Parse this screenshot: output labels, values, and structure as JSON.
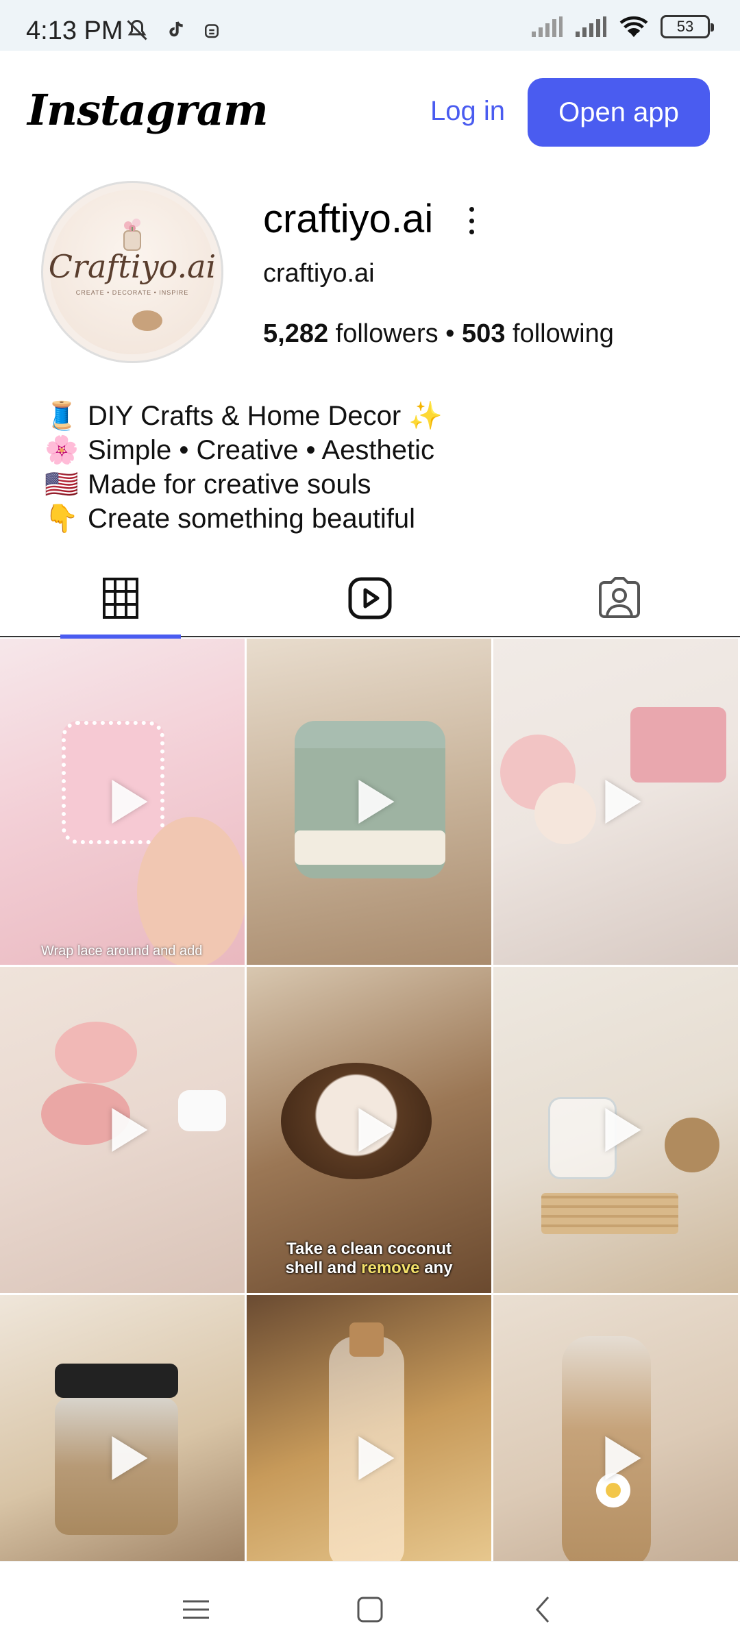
{
  "status_bar": {
    "time": "4:13 PM",
    "battery": "53",
    "icons_left": [
      "mute-icon",
      "tiktok-icon",
      "robot-icon"
    ],
    "icons_right": [
      "signal-icon",
      "signal-icon",
      "wifi-icon",
      "battery-icon"
    ]
  },
  "header": {
    "logo": "Instagram",
    "login_label": "Log in",
    "open_app_label": "Open app",
    "accent_color": "#4a5cf0"
  },
  "profile": {
    "avatar_text": "Craftiyo.ai",
    "avatar_subtext": "CREATE • DECORATE • INSPIRE",
    "username": "craftiyo.ai",
    "full_name": "craftiyo.ai",
    "followers_count": "5,282",
    "followers_label": "followers",
    "separator": "•",
    "following_count": "503",
    "following_label": "following",
    "bio": [
      {
        "emoji": "🧵",
        "text": "DIY Crafts & Home Decor ✨"
      },
      {
        "emoji": "🌸",
        "text": "Simple  •  Creative  •  Aesthetic"
      },
      {
        "emoji": "🇺🇸",
        "text": "Made for creative souls"
      },
      {
        "emoji": "👇",
        "text": "Create something beautiful"
      }
    ]
  },
  "tabs": [
    {
      "name": "grid-icon",
      "active": true
    },
    {
      "name": "reels-icon",
      "active": false
    },
    {
      "name": "tagged-icon",
      "active": false
    }
  ],
  "posts": [
    {
      "caption": "Wrap lace around and add",
      "type": "reel"
    },
    {
      "caption": "",
      "type": "reel"
    },
    {
      "caption": "",
      "type": "reel"
    },
    {
      "caption": "",
      "type": "reel"
    },
    {
      "caption_line1": "Take a clean coconut",
      "caption_line2a": "shell and ",
      "caption_highlight": "remove",
      "caption_line2b": " any",
      "type": "reel"
    },
    {
      "caption": "",
      "type": "reel"
    },
    {
      "caption": "",
      "type": "reel"
    },
    {
      "caption": "",
      "type": "reel"
    },
    {
      "caption": "",
      "type": "reel"
    }
  ],
  "navbar": [
    "menu-icon",
    "home-icon",
    "back-icon"
  ]
}
